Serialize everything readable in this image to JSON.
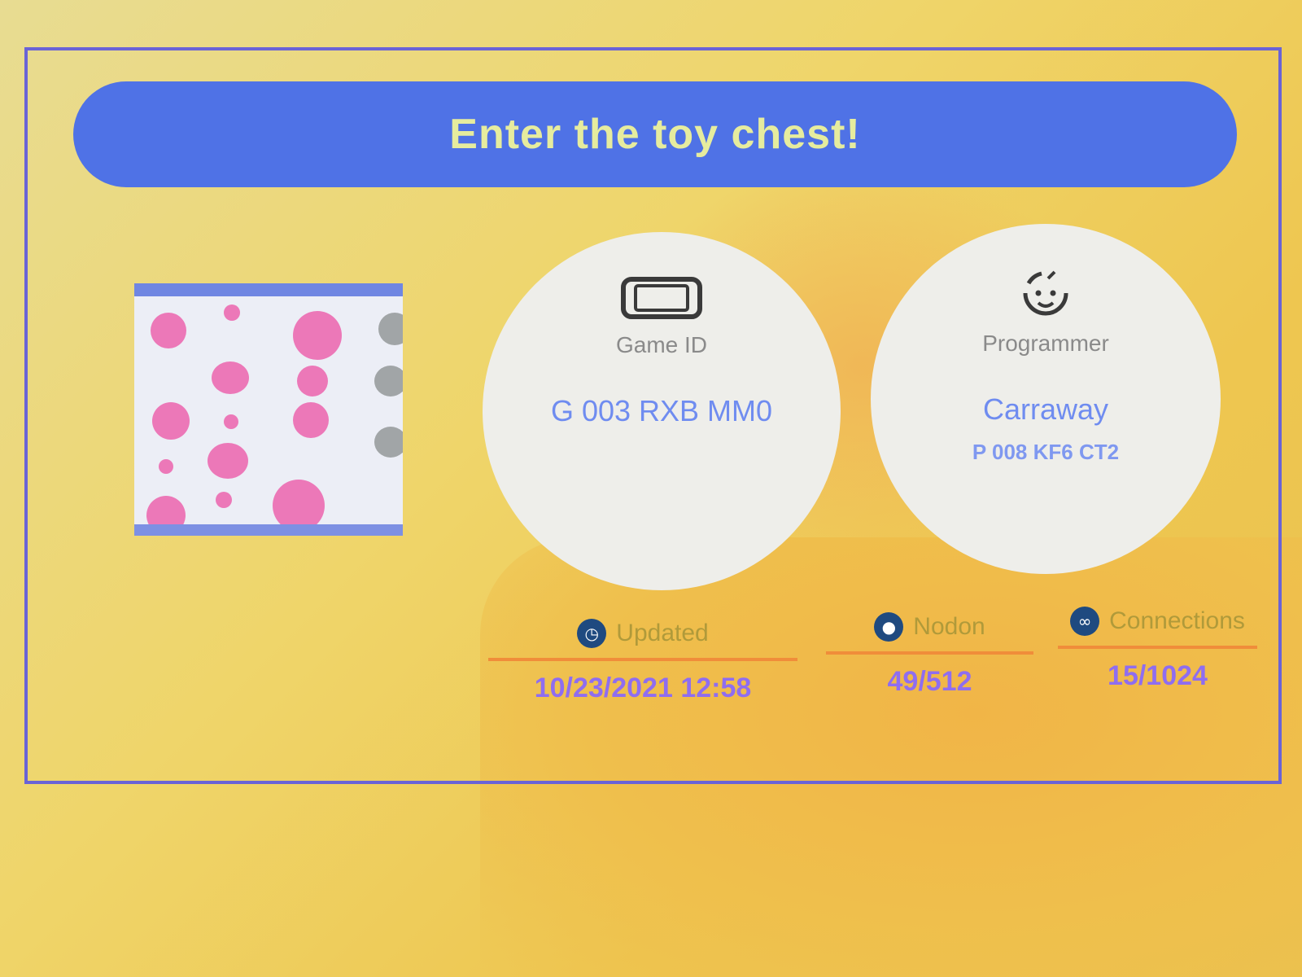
{
  "title": "Enter the toy chest!",
  "info": {
    "game_id": {
      "label": "Game ID",
      "value": "G 003 RXB MM0",
      "icon": "console-icon"
    },
    "programmer": {
      "label": "Programmer",
      "name": "Carraway",
      "id": "P 008 KF6 CT2",
      "icon": "face-icon"
    }
  },
  "stats": [
    {
      "label": "Updated",
      "value": "10/23/2021 12:58",
      "icon": "clock-icon"
    },
    {
      "label": "Nodon",
      "value": "49/512",
      "icon": "nodon-icon"
    },
    {
      "label": "Connections",
      "value": "15/1024",
      "icon": "link-icon"
    }
  ],
  "colors": {
    "accent_blue": "#4f72e6",
    "value_blue": "#6f8cf0",
    "value_purple": "#8f6df0",
    "rule_orange": "#f08d3a"
  }
}
